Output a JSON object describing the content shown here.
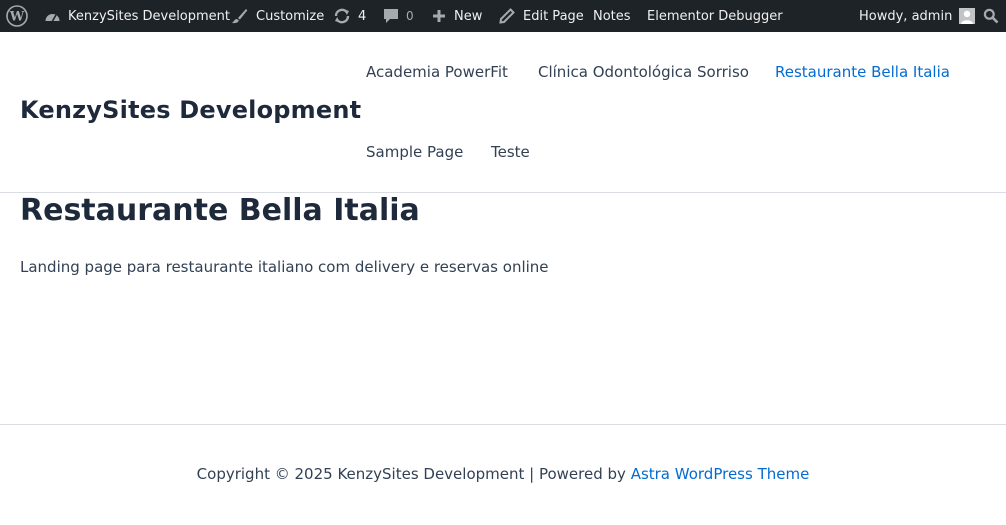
{
  "admin_bar": {
    "site_name": "KenzySites Development",
    "customize": "Customize",
    "updates_count": "4",
    "comments_count": "0",
    "new": "New",
    "edit_page": "Edit Page",
    "notes": "Notes",
    "elementor_debugger": "Elementor Debugger",
    "howdy": "Howdy, admin"
  },
  "header": {
    "site_title": "KenzySites Development",
    "nav": [
      {
        "label": "Academia PowerFit"
      },
      {
        "label": "Clínica Odontológica Sorriso"
      },
      {
        "label": "Restaurante Bella Italia",
        "current": true
      },
      {
        "label": "Sample Page"
      },
      {
        "label": "Teste"
      }
    ]
  },
  "content": {
    "title": "Restaurante Bella Italia",
    "description": "Landing page para restaurante italiano com delivery e reservas online"
  },
  "footer": {
    "copyright": "Copyright © 2025 KenzySites Development | Powered by ",
    "theme_link": "Astra WordPress Theme"
  },
  "colors": {
    "admin_bar_bg": "#1d2327",
    "link_accent": "#046bd2",
    "heading": "#1e293b"
  }
}
